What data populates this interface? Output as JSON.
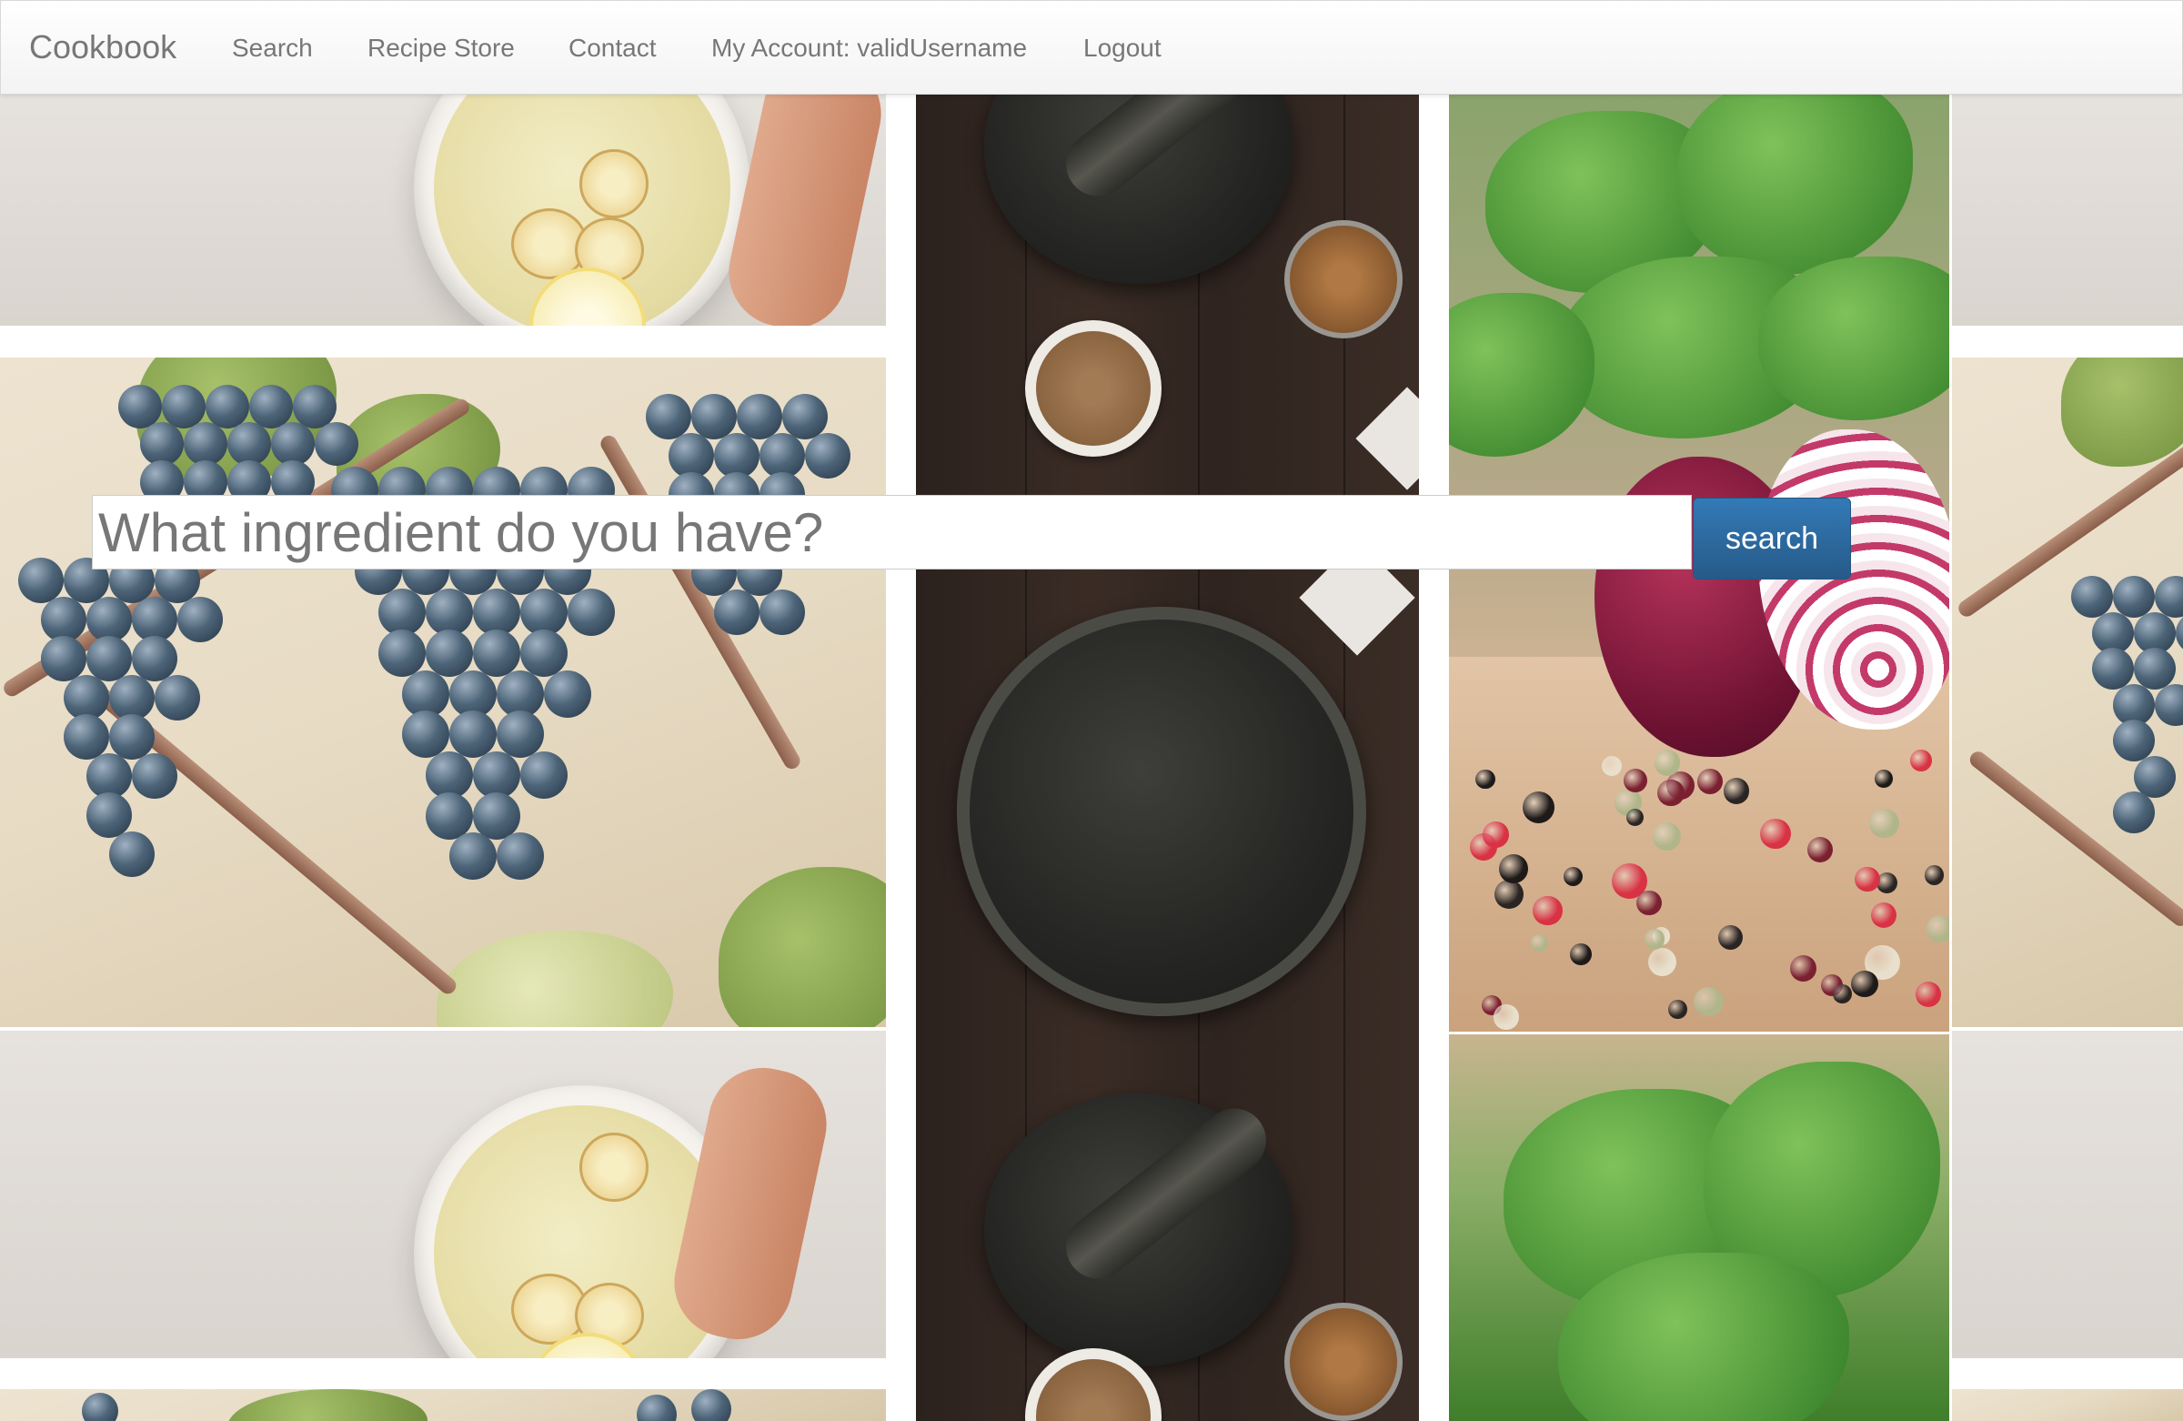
{
  "navbar": {
    "brand": "Cookbook",
    "links": [
      {
        "label": "Search"
      },
      {
        "label": "Recipe Store"
      },
      {
        "label": "Contact"
      },
      {
        "label": "My Account: validUsername"
      },
      {
        "label": "Logout"
      }
    ]
  },
  "search": {
    "placeholder": "What ingredient do you have?",
    "value": "",
    "button_label": "search"
  },
  "background_tiles": [
    {
      "subject": "ginger slices in a bowl"
    },
    {
      "subject": "grapes on the vine"
    },
    {
      "subject": "mortar and pestle with spices"
    },
    {
      "subject": "red onion and peppercorns"
    }
  ],
  "colors": {
    "accent": "#337ab7",
    "nav_text": "#777777"
  }
}
